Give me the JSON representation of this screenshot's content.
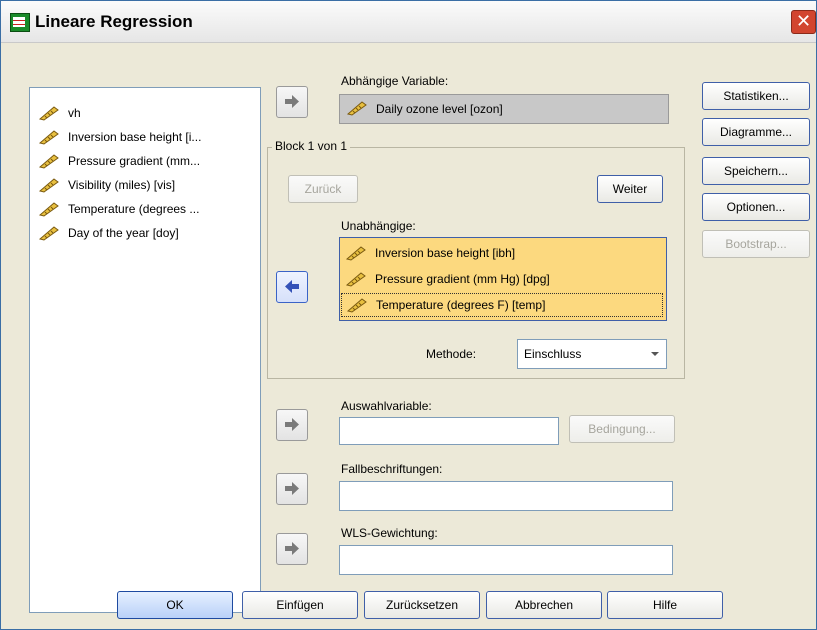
{
  "window": {
    "title": "Lineare Regression",
    "close_label": "✕"
  },
  "source_list": {
    "items": [
      {
        "label": "vh"
      },
      {
        "label": "Inversion base height [i..."
      },
      {
        "label": "Pressure gradient (mm..."
      },
      {
        "label": "Visibility (miles) [vis]"
      },
      {
        "label": "Temperature (degrees ..."
      },
      {
        "label": "Day of the year [doy]"
      }
    ]
  },
  "dependent": {
    "label": "Abhängige Variable:",
    "value": "Daily ozone level [ozon]"
  },
  "block": {
    "title": "Block 1 von 1",
    "back_label": "Zurück",
    "next_label": "Weiter",
    "independent_label": "Unabhängige:",
    "independents": [
      {
        "label": "Inversion base height [ibh]"
      },
      {
        "label": "Pressure gradient (mm Hg) [dpg]"
      },
      {
        "label": "Temperature (degrees F) [temp]"
      }
    ],
    "method_label": "Methode:",
    "method_value": "Einschluss"
  },
  "selection": {
    "label": "Auswahlvariable:",
    "value": "",
    "condition_label": "Bedingung..."
  },
  "case_labels": {
    "label": "Fallbeschriftungen:",
    "value": ""
  },
  "wls": {
    "label": "WLS-Gewichtung:",
    "value": ""
  },
  "side_buttons": {
    "statistics": "Statistiken...",
    "plots": "Diagramme...",
    "save": "Speichern...",
    "options": "Optionen...",
    "bootstrap": "Bootstrap..."
  },
  "footer": {
    "ok": "OK",
    "paste": "Einfügen",
    "reset": "Zurücksetzen",
    "cancel": "Abbrechen",
    "help": "Hilfe"
  },
  "colors": {
    "selected_bg": "#fcd97f",
    "window_bg": "#ECE9D8",
    "accent": "#3f5fa8"
  },
  "icons": {
    "variable": "ruler-scale-icon",
    "move_right": "arrow-right-icon",
    "move_left": "arrow-left-icon"
  }
}
